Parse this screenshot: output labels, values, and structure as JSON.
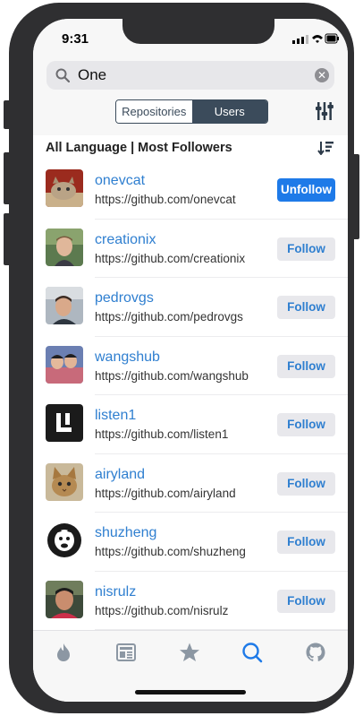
{
  "status": {
    "time": "9:31"
  },
  "search": {
    "query": "One",
    "clear_icon": "clear-icon"
  },
  "segmented": {
    "options": [
      "Repositories",
      "Users"
    ],
    "selected": "Users"
  },
  "filter": {
    "label": "All Language | Most Followers"
  },
  "users": [
    {
      "name": "onevcat",
      "url": "https://github.com/onevcat",
      "button": "Unfollow",
      "primary": true
    },
    {
      "name": "creationix",
      "url": "https://github.com/creationix",
      "button": "Follow",
      "primary": false
    },
    {
      "name": "pedrovgs",
      "url": "https://github.com/pedrovgs",
      "button": "Follow",
      "primary": false
    },
    {
      "name": "wangshub",
      "url": "https://github.com/wangshub",
      "button": "Follow",
      "primary": false
    },
    {
      "name": "listen1",
      "url": "https://github.com/listen1",
      "button": "Follow",
      "primary": false
    },
    {
      "name": "airyland",
      "url": "https://github.com/airyland",
      "button": "Follow",
      "primary": false
    },
    {
      "name": "shuzheng",
      "url": "https://github.com/shuzheng",
      "button": "Follow",
      "primary": false
    },
    {
      "name": "nisrulz",
      "url": "https://github.com/nisrulz",
      "button": "Follow",
      "primary": false
    }
  ],
  "tabs": [
    {
      "icon": "flame-icon",
      "active": false
    },
    {
      "icon": "news-icon",
      "active": false
    },
    {
      "icon": "star-icon",
      "active": false
    },
    {
      "icon": "search-icon",
      "active": true
    },
    {
      "icon": "github-icon",
      "active": false
    }
  ],
  "colors": {
    "accent": "#1e7ae8",
    "link": "#2f7fd0",
    "segment": "#3b4b5b",
    "tab_inactive": "#8c97a3"
  }
}
